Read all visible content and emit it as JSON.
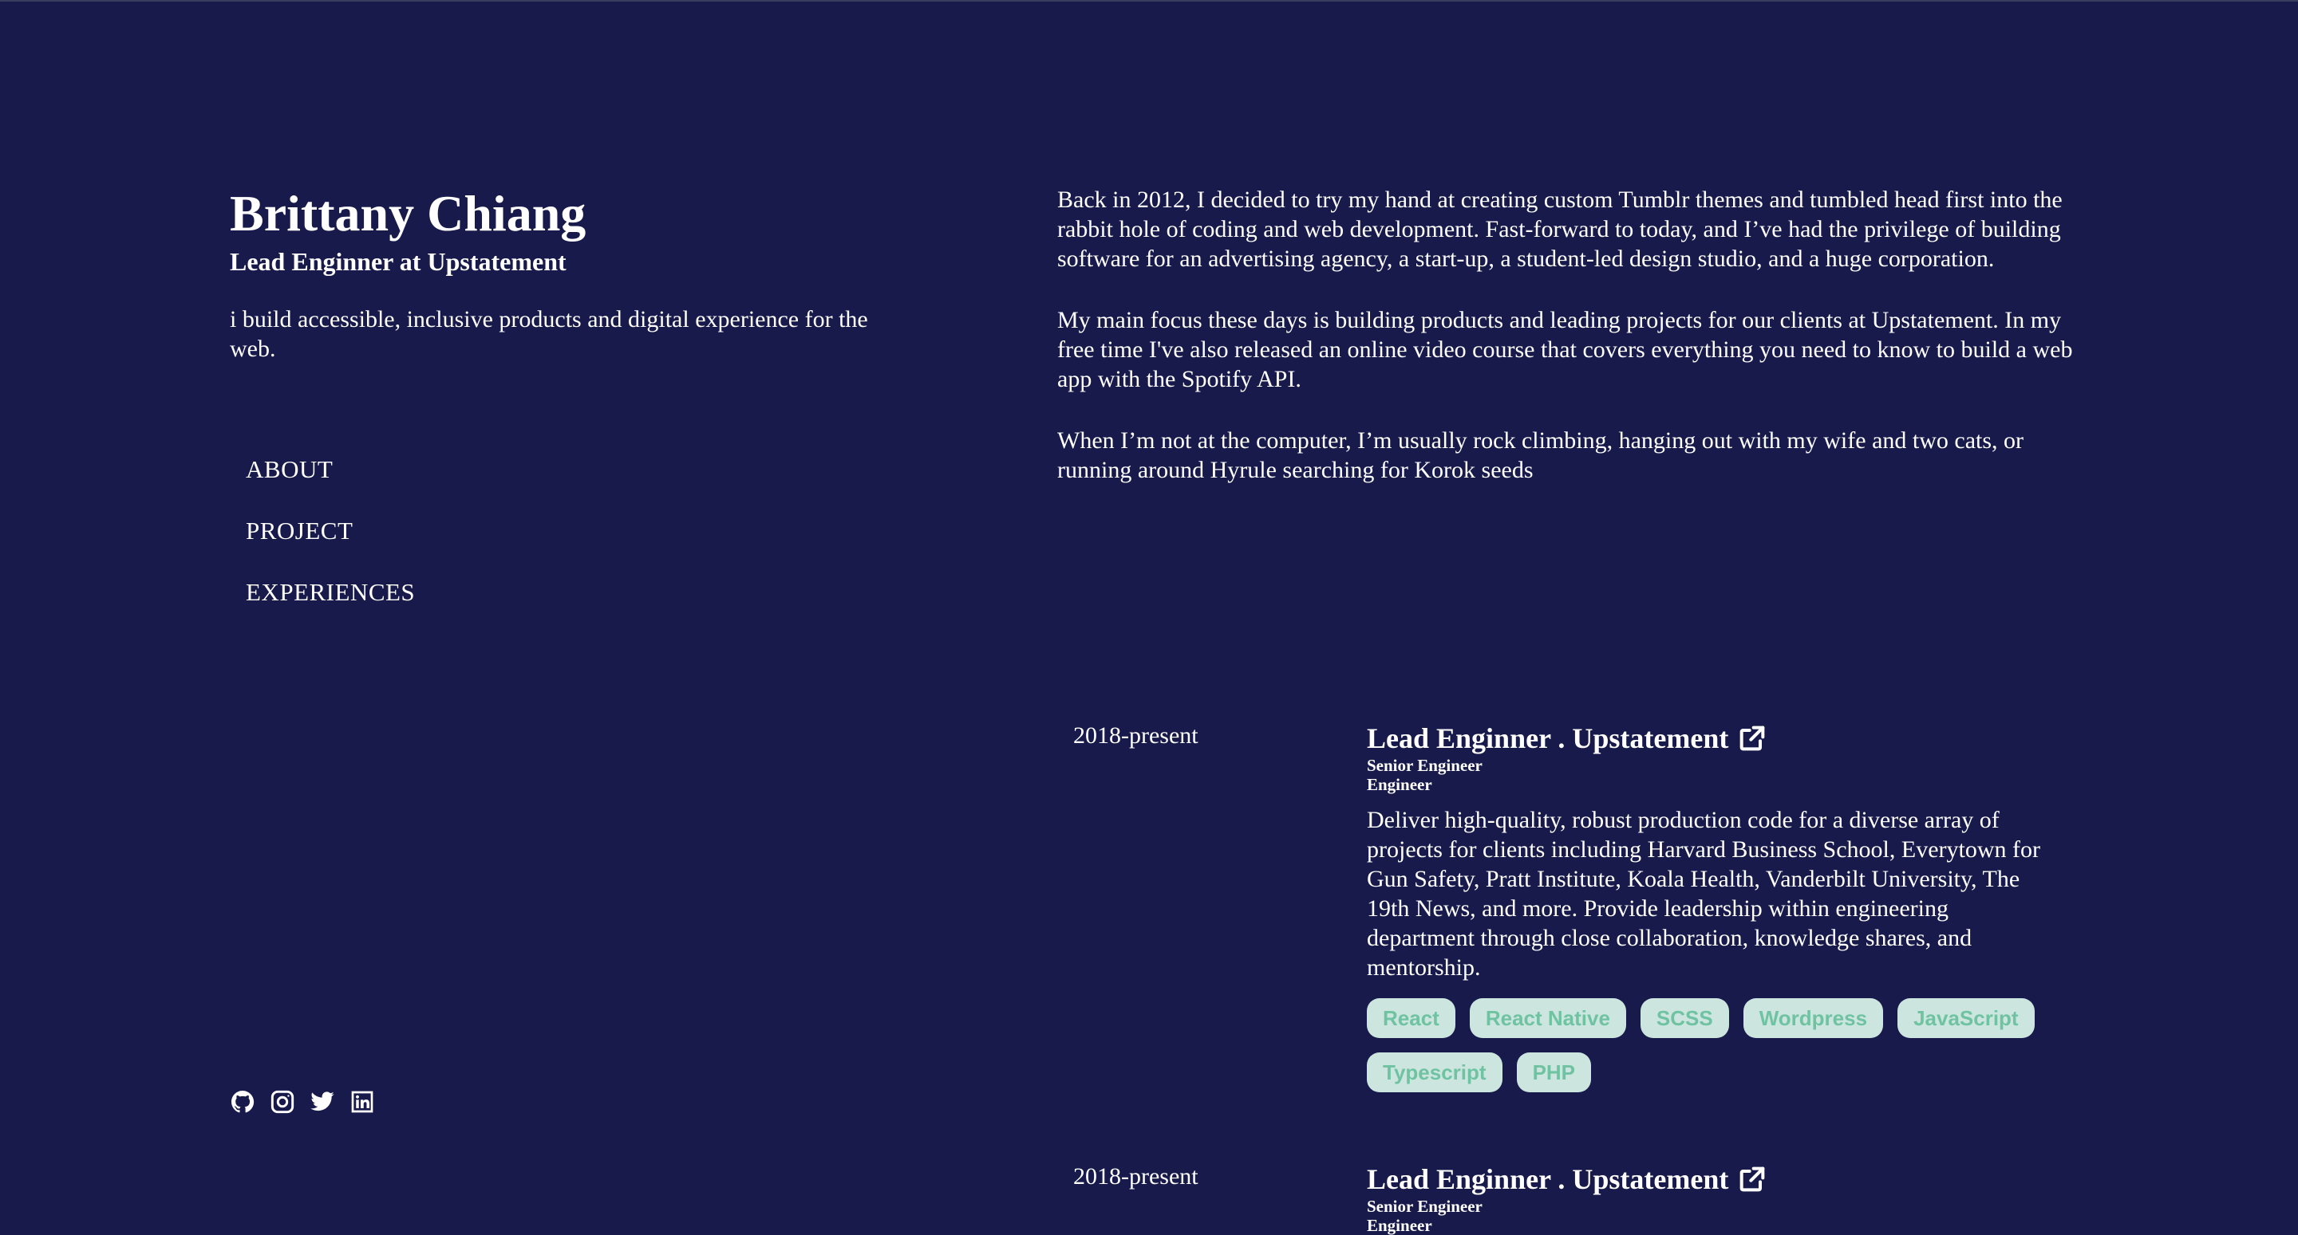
{
  "header": {
    "name": "Brittany Chiang",
    "role": "Lead Enginner at Upstatement",
    "tagline": "i build accessible, inclusive products and digital experience for the web."
  },
  "nav": {
    "items": [
      {
        "label": "ABOUT"
      },
      {
        "label": "PROJECT"
      },
      {
        "label": "EXPERIENCES"
      }
    ]
  },
  "socials": {
    "icons": [
      "github-icon",
      "instagram-icon",
      "twitter-icon",
      "linkedin-icon"
    ]
  },
  "about": {
    "paragraphs": [
      "Back in 2012, I decided to try my hand at creating custom Tumblr themes and tumbled head first into the rabbit hole of coding and web development. Fast-forward to today, and I’ve had the privilege of building software for an advertising agency, a start-up, a student-led design studio, and a huge corporation.",
      "My main focus these days is building products and leading projects for our clients at Upstatement. In my free time I've also released an online video course that covers everything you need to know to build a web app with the Spotify API.",
      "When I’m not at the computer, I’m usually rock climbing, hanging out with my wife and two cats, or running around Hyrule searching for Korok seeds"
    ]
  },
  "experiences": [
    {
      "date": "2018-present",
      "title": "Lead Enginner . Upstatement",
      "subtitle_1": "Senior Engineer",
      "subtitle_2": "Engineer",
      "description": "Deliver high-quality, robust production code for a diverse array of projects for clients including Harvard Business School, Everytown for Gun Safety, Pratt Institute, Koala Health, Vanderbilt University, The 19th News, and more. Provide leadership within engineering department through close collaboration, knowledge shares, and mentorship.",
      "tags": [
        "React",
        "React Native",
        "SCSS",
        "Wordpress",
        "JavaScript",
        "Typescript",
        "PHP"
      ]
    },
    {
      "date": "2018-present",
      "title": "Lead Enginner . Upstatement",
      "subtitle_1": "Senior Engineer",
      "subtitle_2": "Engineer"
    }
  ],
  "colors": {
    "background": "#181a4b",
    "text": "#ffffff",
    "tag_bg": "#cce6df",
    "tag_text": "#6fc3a2"
  }
}
